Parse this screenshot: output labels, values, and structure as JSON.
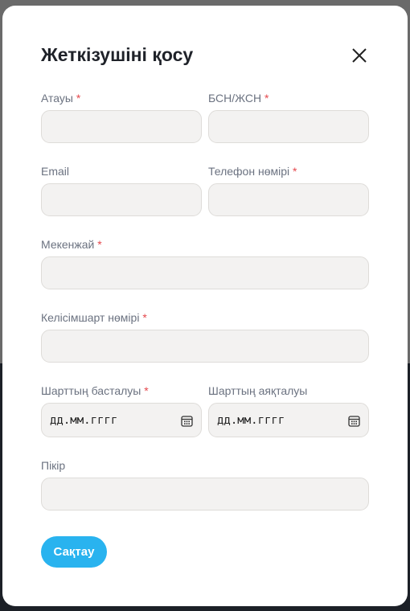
{
  "dialog": {
    "title": "Жеткізушіні қосу",
    "close_icon": "close-icon"
  },
  "fields": {
    "name": {
      "label": "Атауы",
      "required_mark": "*",
      "value": ""
    },
    "bin": {
      "label": "БСН/ЖСН",
      "required_mark": "*",
      "value": ""
    },
    "email": {
      "label": "Email",
      "value": ""
    },
    "phone": {
      "label": "Телефон нөмірі",
      "required_mark": "*",
      "value": ""
    },
    "address": {
      "label": "Мекенжай",
      "required_mark": "*",
      "value": ""
    },
    "contract_number": {
      "label": "Келісімшарт нөмірі",
      "required_mark": "*",
      "value": ""
    },
    "contract_start": {
      "label": "Шарттың басталуы",
      "required_mark": "*",
      "placeholder": "дд.мм.гггг",
      "icon": "calendar-icon"
    },
    "contract_end": {
      "label": "Шарттың аяқталуы",
      "placeholder": "дд.мм.гггг",
      "icon": "calendar-icon"
    },
    "comment": {
      "label": "Пікір",
      "value": ""
    }
  },
  "actions": {
    "save_label": "Сақтау"
  },
  "colors": {
    "accent": "#29b3ef",
    "required": "#e5484d",
    "field_bg": "#f3f2f1"
  }
}
